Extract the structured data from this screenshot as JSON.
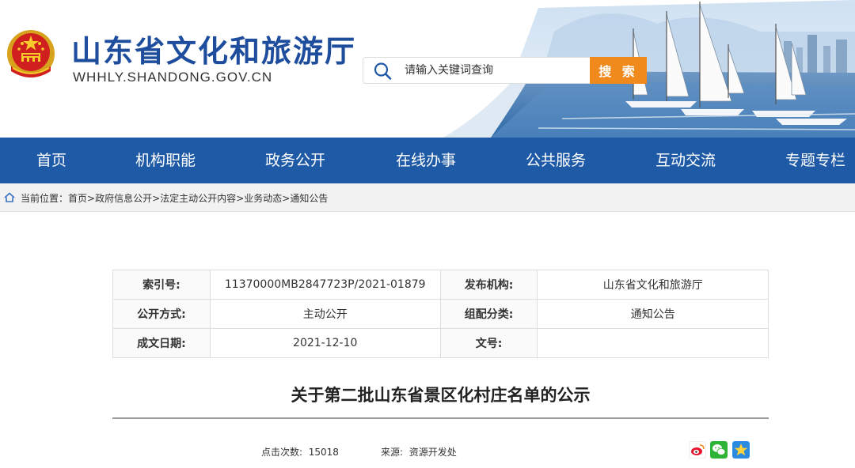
{
  "header": {
    "title": "山东省文化和旅游厅",
    "url": "WHHLY.SHANDONG.GOV.CN",
    "colors": {
      "brand_blue": "#1d4d9c",
      "accent_orange": "#f08a1c",
      "nav_blue": "#1f5aa7"
    }
  },
  "search": {
    "placeholder": "请输入关键词查询",
    "button_label": "搜 索",
    "icon": "search-icon"
  },
  "nav": {
    "items": [
      {
        "label": "首页"
      },
      {
        "label": "机构职能"
      },
      {
        "label": "政务公开"
      },
      {
        "label": "在线办事"
      },
      {
        "label": "公共服务"
      },
      {
        "label": "互动交流"
      },
      {
        "label": "专题专栏"
      }
    ]
  },
  "breadcrumb": {
    "prefix": "当前位置：",
    "items": [
      "首页",
      "政府信息公开",
      "法定主动公开内容",
      "业务动态",
      "通知公告"
    ],
    "separator": ">"
  },
  "meta": {
    "rows": [
      {
        "k1": "索引号:",
        "v1": "11370000MB2847723P/2021-01879",
        "k2": "发布机构:",
        "v2": "山东省文化和旅游厅"
      },
      {
        "k1": "公开方式:",
        "v1": "主动公开",
        "k2": "组配分类:",
        "v2": "通知公告"
      },
      {
        "k1": "成文日期:",
        "v1": "2021-12-10",
        "k2": "文号:",
        "v2": ""
      }
    ]
  },
  "article": {
    "title": "关于第二批山东省景区化村庄名单的公示",
    "views_label": "点击次数:",
    "views_value": "15018",
    "source_label": "来源:",
    "source_value": "资源开发处"
  },
  "share": {
    "items": [
      {
        "name": "weibo-icon",
        "color": "#e6162d"
      },
      {
        "name": "wechat-icon",
        "color": "#2db436"
      },
      {
        "name": "qzone-icon",
        "color": "#2b8be0"
      }
    ]
  }
}
